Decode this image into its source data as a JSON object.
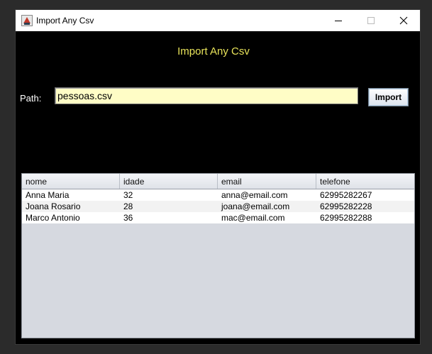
{
  "window": {
    "title": "Import Any Csv"
  },
  "heading": "Import Any Csv",
  "path": {
    "label": "Path:",
    "value": "pessoas.csv"
  },
  "import_button": "Import",
  "colors": {
    "heading": "#e8e35a",
    "input_bg": "#fffdc6",
    "window_bg": "#000000",
    "table_bg": "#d6d9e0"
  },
  "table": {
    "columns": [
      "nome",
      "idade",
      "email",
      "telefone"
    ],
    "rows": [
      [
        "Anna Maria",
        "32",
        "anna@email.com",
        "62995282267"
      ],
      [
        "Joana Rosario",
        "28",
        "joana@email.com",
        "62995282228"
      ],
      [
        "Marco Antonio",
        "36",
        "mac@email.com",
        "62995282288"
      ]
    ]
  }
}
